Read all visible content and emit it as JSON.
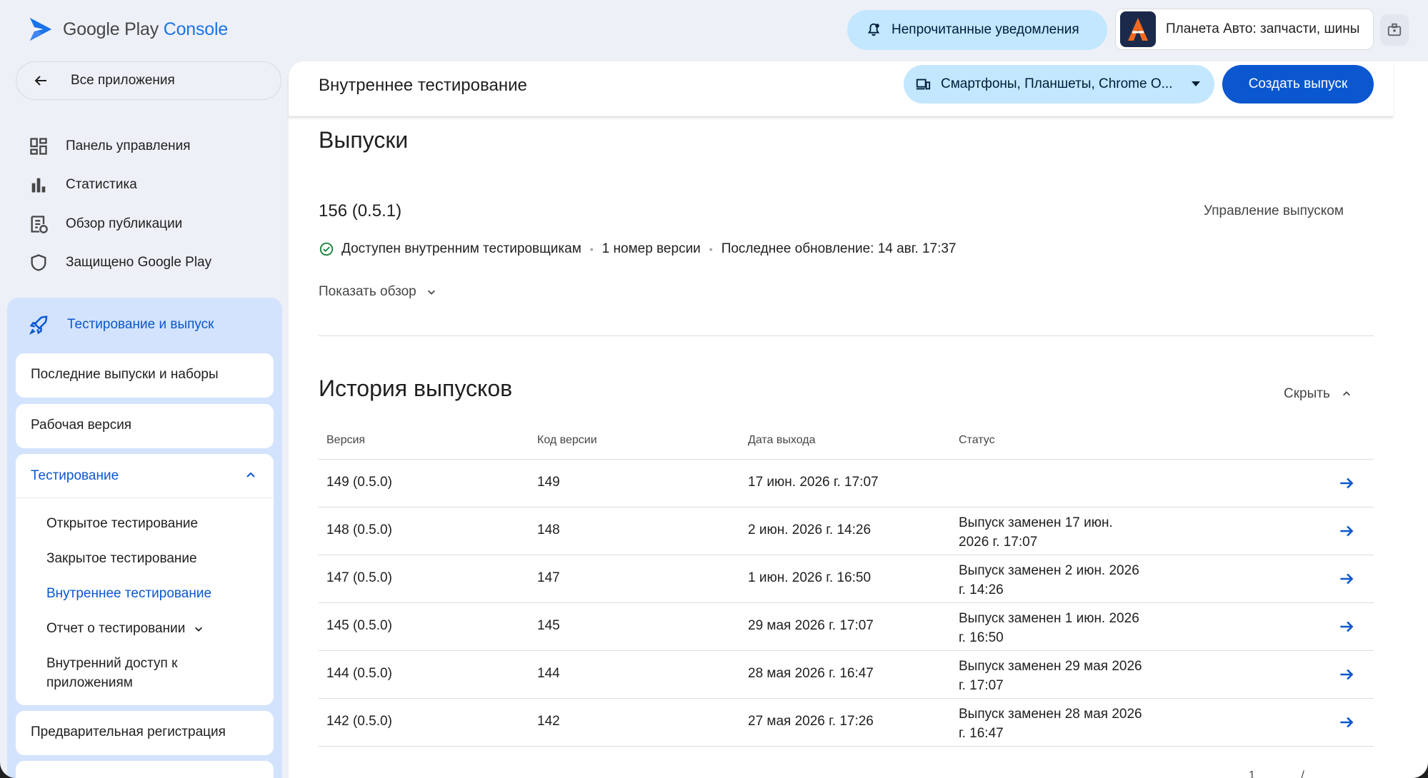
{
  "header": {
    "logo_text_main": "Google Play",
    "logo_text_accent": "Console",
    "notifications_label": "Непрочитанные уведомления",
    "app_name": "Планета Авто: запчасти, шины"
  },
  "sidebar": {
    "back_label": "Все приложения",
    "nav": [
      {
        "label": "Панель управления",
        "icon": "dashboard-icon"
      },
      {
        "label": "Статистика",
        "icon": "bar-chart-icon"
      },
      {
        "label": "Обзор публикации",
        "icon": "publishing-overview-icon"
      },
      {
        "label": "Защищено Google Play",
        "icon": "shield-icon"
      }
    ],
    "section_label": "Тестирование и выпуск",
    "cards": {
      "latest": "Последние выпуски и наборы",
      "production": "Рабочая версия",
      "testing": "Тестирование",
      "prereg": "Предварительная регистрация"
    },
    "testing_items": {
      "open": "Открытое тестирование",
      "closed": "Закрытое тестирование",
      "internal": "Внутреннее тестирование",
      "report": "Отчет о тестировании",
      "app_sharing": "Внутренний доступ к приложениям"
    }
  },
  "main": {
    "page_title": "Внутреннее тестирование",
    "device_filter": "Смартфоны, Планшеты, Chrome O...",
    "create_button": "Создать выпуск",
    "releases_heading": "Выпуски",
    "release": {
      "version": "156 (0.5.1)",
      "manage_label": "Управление выпуском",
      "status": "Доступен внутренним тестировщикам",
      "version_count": "1 номер версии",
      "last_update": "Последнее обновление: 14 авг. 17:37",
      "overview_toggle": "Показать обзор"
    },
    "history_heading": "История выпусков",
    "hide_label": "Скрыть",
    "columns": [
      "Версия",
      "Код версии",
      "Дата выхода",
      "Статус"
    ],
    "rows": [
      {
        "version": "149 (0.5.0)",
        "code": "149",
        "date": "17 июн. 2026 г. 17:07",
        "status": ""
      },
      {
        "version": "148 (0.5.0)",
        "code": "148",
        "date": "2 июн. 2026 г. 14:26",
        "status": "Выпуск заменен 17 июн. 2026 г. 17:07"
      },
      {
        "version": "147 (0.5.0)",
        "code": "147",
        "date": "1 июн. 2026 г. 16:50",
        "status": "Выпуск заменен 2 июн. 2026 г. 14:26"
      },
      {
        "version": "145 (0.5.0)",
        "code": "145",
        "date": "29 мая 2026 г. 17:07",
        "status": "Выпуск заменен 1 июн. 2026 г. 16:50"
      },
      {
        "version": "144 (0.5.0)",
        "code": "144",
        "date": "28 мая 2026 г. 16:47",
        "status": "Выпуск заменен 29 мая 2026 г. 17:07"
      },
      {
        "version": "142 (0.5.0)",
        "code": "142",
        "date": "27 мая 2026 г. 17:26",
        "status": "Выпуск заменен 28 мая 2026 г. 16:47"
      }
    ],
    "pager_text": "1 /"
  },
  "colors": {
    "accent": "#0b57d0",
    "tonal": "#c2e7ff",
    "section_bg": "#d3e3fd",
    "success": "#188038"
  }
}
